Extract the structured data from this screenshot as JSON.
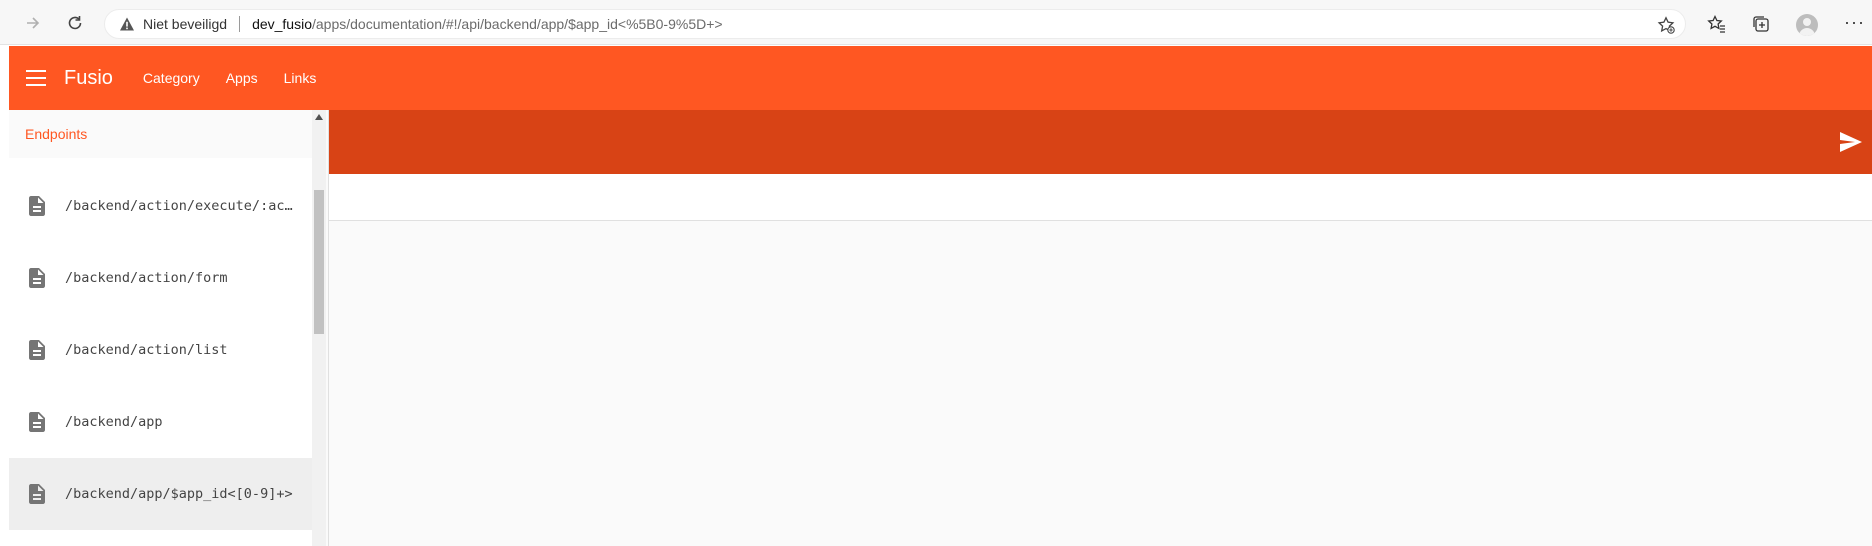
{
  "browser": {
    "insecure_label": "Niet beveiligd",
    "url_host": "dev_fusio",
    "url_path": "/apps/documentation/#!/api/backend/app/$app_id<%5B0-9%5D+>"
  },
  "app": {
    "title": "Fusio",
    "nav": {
      "category": "Category",
      "apps": "Apps",
      "links": "Links"
    },
    "accent_color": "#ff5722",
    "dark_accent_color": "#d84315"
  },
  "sidebar": {
    "header": "Endpoints",
    "endpoints": [
      {
        "label": "/backend/action/execute/:action_id",
        "icon": "document-icon"
      },
      {
        "label": "/backend/action/form",
        "icon": "document-icon"
      },
      {
        "label": "/backend/action/list",
        "icon": "document-icon"
      },
      {
        "label": "/backend/app",
        "icon": "document-icon"
      },
      {
        "label": "/backend/app/$app_id<[0-9]+>",
        "icon": "document-icon",
        "selected": true
      }
    ]
  }
}
